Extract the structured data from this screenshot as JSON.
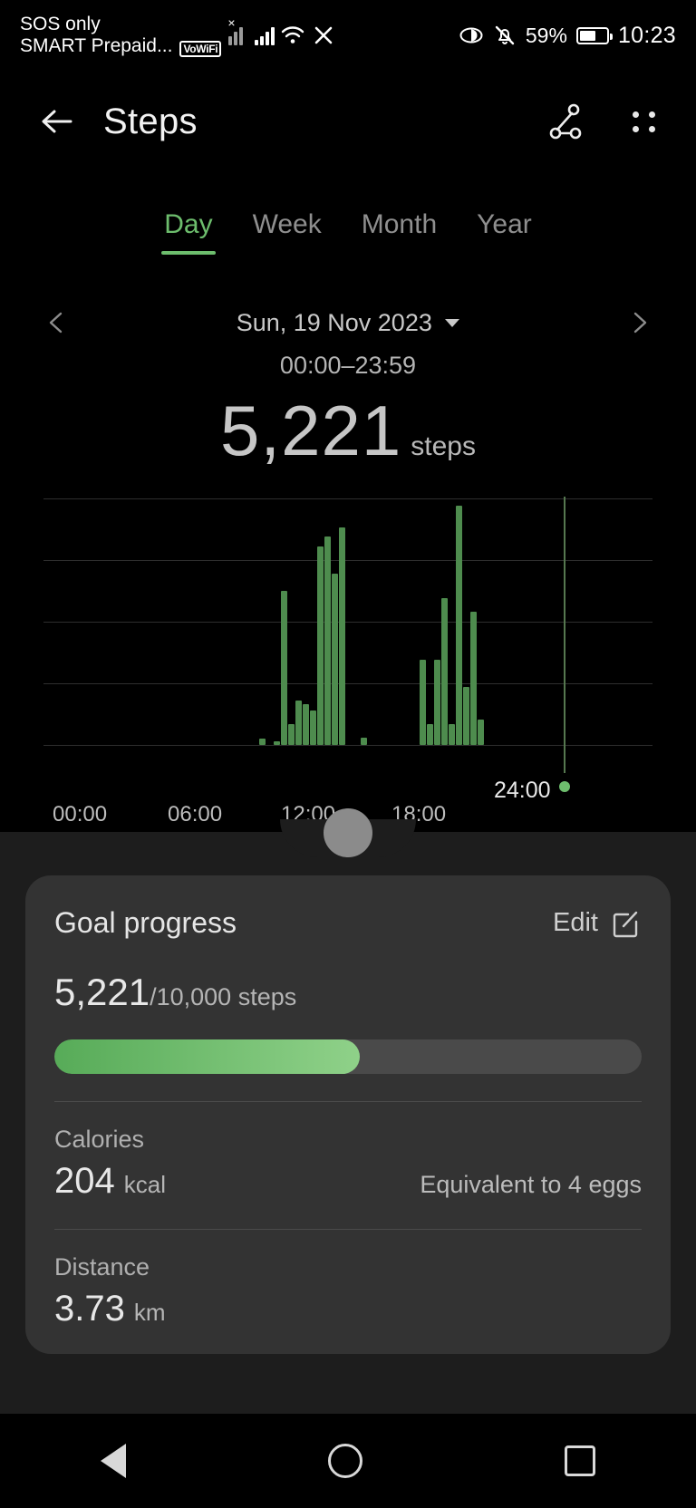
{
  "status_bar": {
    "carrier_line1": "SOS only",
    "carrier_line2": "SMART Prepaid...",
    "vowifi_badge": "VoWiFi",
    "battery_percent": "59%",
    "clock": "10:23",
    "icons": [
      "signal-no-service-icon",
      "signal-bars-icon",
      "wifi-icon",
      "x-icon",
      "eye-comfort-icon",
      "bell-muted-icon",
      "battery-icon"
    ]
  },
  "app_bar": {
    "title": "Steps",
    "back_icon": "back-arrow-icon",
    "share_icon": "share-nodes-icon",
    "menu_icon": "four-dot-menu-icon"
  },
  "tabs": [
    {
      "label": "Day",
      "active": true
    },
    {
      "label": "Week",
      "active": false
    },
    {
      "label": "Month",
      "active": false
    },
    {
      "label": "Year",
      "active": false
    }
  ],
  "date_nav": {
    "prev_icon": "chevron-left-icon",
    "next_icon": "chevron-right-icon",
    "date": "Sun, 19 Nov 2023",
    "dropdown_icon": "caret-down-icon"
  },
  "summary": {
    "time_range": "00:00–23:59",
    "value": "5,221",
    "unit": "steps"
  },
  "chart_data": {
    "type": "bar",
    "title": "Steps",
    "xlabel": "",
    "ylabel": "",
    "ylim": [
      0,
      720
    ],
    "yticks": [
      0,
      180,
      360,
      540,
      720
    ],
    "ytick_labels": [
      "0",
      "180",
      "360",
      "540",
      "720"
    ],
    "xticks": [
      "00:00",
      "06:00",
      "12:00",
      "18:00",
      "24:00"
    ],
    "xtick_positions_hours": [
      0,
      6,
      12,
      18,
      24
    ],
    "grid": true,
    "legend": false,
    "bar_color": "#4e8c4e",
    "marker_time": "24:00",
    "marker_color": "#6dbd6d",
    "x": [
      "09:50",
      "10:30",
      "10:50",
      "11:10",
      "11:30",
      "11:50",
      "12:10",
      "12:30",
      "12:50",
      "13:10",
      "13:30",
      "14:30",
      "17:10",
      "17:30",
      "17:50",
      "18:10",
      "18:30",
      "18:50",
      "19:10",
      "19:30",
      "19:50"
    ],
    "values": [
      18,
      10,
      450,
      60,
      130,
      120,
      100,
      580,
      610,
      500,
      635,
      22,
      250,
      60,
      250,
      430,
      60,
      700,
      170,
      390,
      75
    ]
  },
  "goal_card": {
    "title": "Goal progress",
    "edit_label": "Edit",
    "edit_icon": "edit-pencil-icon",
    "current": "5,221",
    "target_text": "/10,000 steps",
    "progress_percent": 52,
    "progress_color_start": "#57ab58",
    "progress_color_end": "#8fd189",
    "stats": [
      {
        "label": "Calories",
        "value": "204",
        "unit": "kcal",
        "aside": "Equivalent to 4 eggs"
      },
      {
        "label": "Distance",
        "value": "3.73",
        "unit": "km",
        "aside": ""
      }
    ]
  },
  "nav_bar": {
    "back_icon": "nav-back-triangle-icon",
    "home_icon": "nav-home-circle-icon",
    "recents_icon": "nav-recents-square-icon"
  }
}
